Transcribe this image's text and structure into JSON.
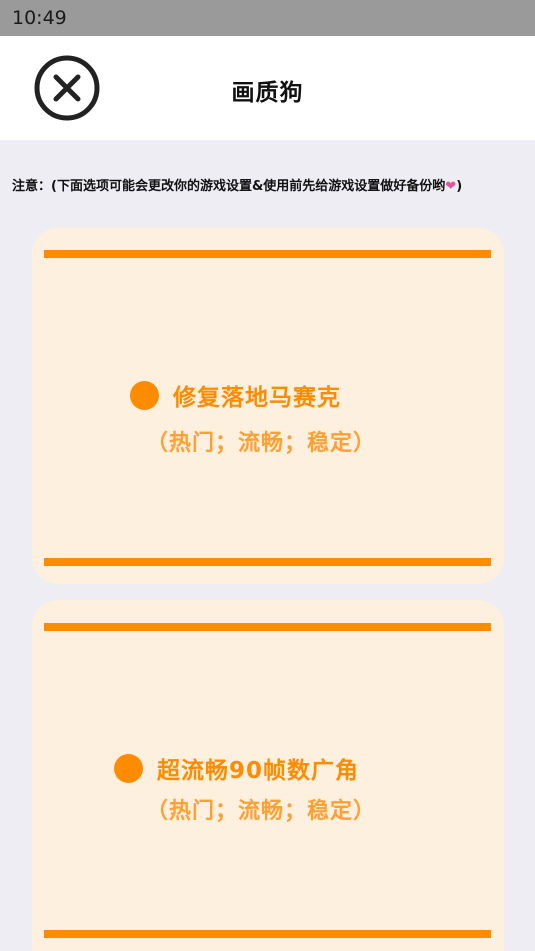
{
  "status_bar": {
    "time": "10:49"
  },
  "header": {
    "title": "画质狗",
    "close_icon": "close-circle-icon"
  },
  "notice": {
    "text": "注意：(下面选项可能会更改你的游戏设置&使用前先给游戏设置做好备份哟",
    "heart": "❤",
    "close_paren": ")"
  },
  "options": [
    {
      "bullet_icon": "dot-icon",
      "name": "修复落地马赛克",
      "tags": "（热门；流畅；稳定）"
    },
    {
      "bullet_icon": "dot-icon",
      "name": "超流畅90帧数广角",
      "tags": "（热门；流畅；稳定）"
    }
  ],
  "colors": {
    "accent": "#ff8c00",
    "card_background": "#fdf0df",
    "page_background": "#eeedf3",
    "heart": "#e2559a"
  }
}
